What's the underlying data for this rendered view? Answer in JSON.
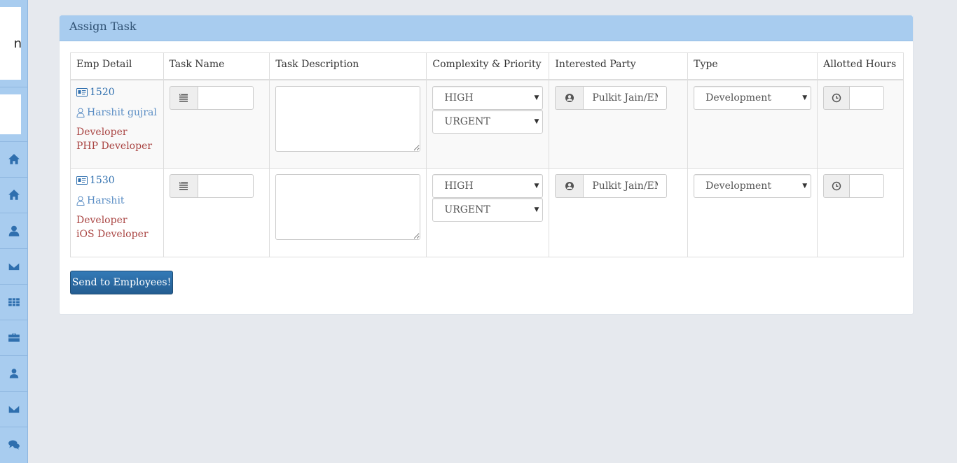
{
  "sidebar": {
    "logo_text": "n",
    "nav_items": [
      {
        "icon": "home-icon"
      },
      {
        "icon": "home-icon"
      },
      {
        "icon": "user-icon"
      },
      {
        "icon": "envelope-icon"
      },
      {
        "icon": "table-icon"
      },
      {
        "icon": "briefcase-icon"
      },
      {
        "icon": "user-icon"
      },
      {
        "icon": "envelope-icon"
      },
      {
        "icon": "comments-icon"
      }
    ]
  },
  "panel": {
    "title": "Assign Task"
  },
  "table": {
    "headers": [
      "Emp Detail",
      "Task Name",
      "Task Description",
      "Complexity & Priority",
      "Interested Party",
      "Type",
      "Allotted Hours"
    ],
    "rows": [
      {
        "emp_id": "1520",
        "name": "Harshit gujral",
        "role": "Developer",
        "designation": "PHP Developer",
        "task_name": "",
        "task_description": "",
        "complexity": "HIGH",
        "priority": "URGENT",
        "interested_party": "Pulkit Jain/EMP",
        "type": "Development",
        "allotted_hours": ""
      },
      {
        "emp_id": "1530",
        "name": "Harshit",
        "role": "Developer",
        "designation": "iOS Developer",
        "task_name": "",
        "task_description": "",
        "complexity": "HIGH",
        "priority": "URGENT",
        "interested_party": "Pulkit Jain/EMP",
        "type": "Development",
        "allotted_hours": ""
      }
    ]
  },
  "actions": {
    "send_label": "Send to Employees!"
  },
  "colors": {
    "sidebar_bg": "#a8ccef",
    "panel_heading_bg": "#a8ccef",
    "primary_button": "#337ab7",
    "role_text": "#a94442",
    "link_text": "#2f6fae"
  }
}
